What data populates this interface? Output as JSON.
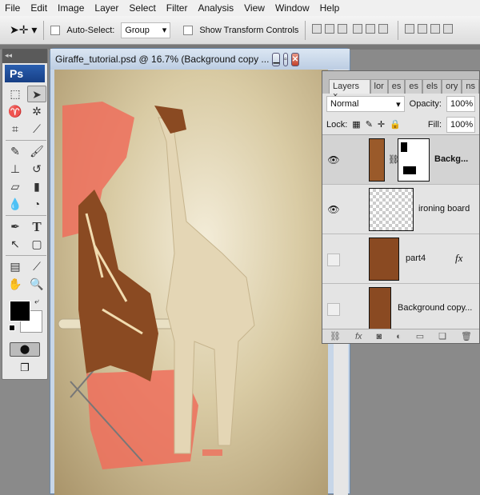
{
  "menu": [
    "File",
    "Edit",
    "Image",
    "Layer",
    "Select",
    "Filter",
    "Analysis",
    "View",
    "Window",
    "Help"
  ],
  "options": {
    "auto_select_label": "Auto-Select:",
    "auto_select_value": "Group",
    "show_transform_label": "Show Transform Controls"
  },
  "toolbox": {
    "logo": "Ps",
    "collapse": "◂◂",
    "tools": [
      "rect-marquee",
      "move",
      "lasso",
      "magic-wand",
      "crop",
      "slice",
      "healing-brush",
      "brush",
      "clone-stamp",
      "history-brush",
      "eraser",
      "gradient",
      "blur",
      "dodge",
      "pen",
      "type",
      "path-select",
      "shape",
      "notes",
      "eyedropper",
      "hand",
      "zoom"
    ],
    "foreground": "#000000",
    "background": "#ffffff"
  },
  "document": {
    "title": "Giraffe_tutorial.psd @ 16.7% (Background copy ..."
  },
  "layers_panel": {
    "tabs": [
      "Layers",
      "lor",
      "es",
      "es",
      "els",
      "ory",
      "ns"
    ],
    "blend_mode": "Normal",
    "opacity_label": "Opacity:",
    "opacity": "100%",
    "lock_label": "Lock:",
    "fill_label": "Fill:",
    "fill": "100%",
    "layers": [
      {
        "name": "Backg...",
        "visible": true,
        "selected": true,
        "mask": true
      },
      {
        "name": "ironing board",
        "visible": true
      },
      {
        "name": "part4",
        "visible": false,
        "fx": "fx"
      },
      {
        "name": "Background copy...",
        "visible": false
      }
    ]
  },
  "colors": {
    "mask_paint": "#ef6f5c",
    "accent": "#1f4f9e"
  }
}
